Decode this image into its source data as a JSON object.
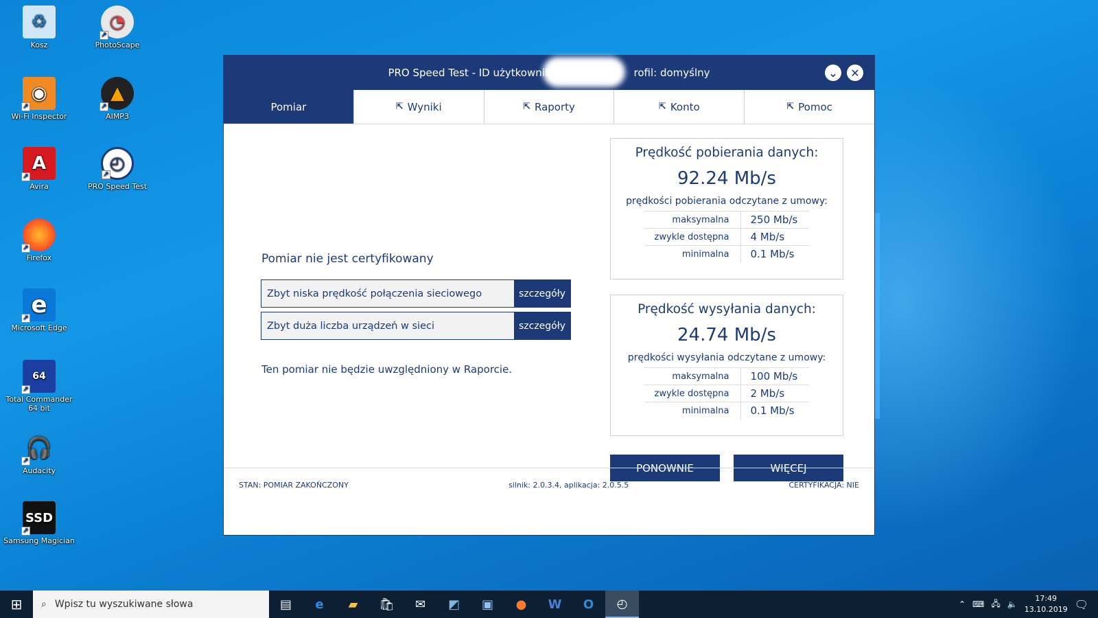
{
  "desktop": {
    "icons": [
      {
        "label": "Kosz",
        "icon": "recycle-bin-icon"
      },
      {
        "label": "PhotoScape",
        "icon": "photoscape-icon"
      },
      {
        "label": "Wi-Fi Inspector",
        "icon": "wifi-inspector-icon"
      },
      {
        "label": "AIMP3",
        "icon": "aimp-icon"
      },
      {
        "label": "Avira",
        "icon": "avira-icon"
      },
      {
        "label": "PRO Speed Test",
        "icon": "speedtest-icon"
      },
      {
        "label": "Firefox",
        "icon": "firefox-icon"
      },
      {
        "label": "Microsoft Edge",
        "icon": "edge-icon"
      },
      {
        "label": "Total Commander 64 bit",
        "icon": "total-commander-icon"
      },
      {
        "label": "Audacity",
        "icon": "audacity-icon"
      },
      {
        "label": "Samsung Magician",
        "icon": "samsung-magician-icon"
      }
    ]
  },
  "window": {
    "title_left": "PRO Speed Test - ID użytkownika",
    "title_right": "rofil: domyślny",
    "tabs": [
      {
        "label": "Pomiar",
        "active": true
      },
      {
        "label": "Wyniki"
      },
      {
        "label": "Raporty"
      },
      {
        "label": "Konto"
      },
      {
        "label": "Pomoc"
      }
    ],
    "not_certified": "Pomiar nie jest certyfikowany",
    "issues": [
      {
        "text": "Zbyt niska prędkość połączenia sieciowego",
        "button": "szczegóły"
      },
      {
        "text": "Zbyt duża liczba urządzeń w sieci",
        "button": "szczegóły"
      }
    ],
    "note": "Ten pomiar nie będzie uwzględniony w Raporcie.",
    "download": {
      "title": "Prędkość pobierania danych:",
      "speed": "92.24 Mb/s",
      "subtitle": "prędkości pobierania odczytane z umowy:",
      "rows": [
        {
          "key": "maksymalna",
          "value": "250 Mb/s"
        },
        {
          "key": "zwykle dostępna",
          "value": "4 Mb/s"
        },
        {
          "key": "minimalna",
          "value": "0.1 Mb/s"
        }
      ]
    },
    "upload": {
      "title": "Prędkość wysyłania danych:",
      "speed": "24.74 Mb/s",
      "subtitle": "prędkości wysyłania odczytane z umowy:",
      "rows": [
        {
          "key": "maksymalna",
          "value": "100 Mb/s"
        },
        {
          "key": "zwykle dostępna",
          "value": "2 Mb/s"
        },
        {
          "key": "minimalna",
          "value": "0.1 Mb/s"
        }
      ]
    },
    "buttons": {
      "again": "PONOWNIE",
      "more": "WIĘCEJ"
    },
    "status": {
      "state": "STAN: POMIAR ZAKOŃCZONY",
      "version": "silnik: 2.0.3.4, aplikacja: 2.0.5.5",
      "cert": "CERTYFIKACJA: NIE"
    }
  },
  "taskbar": {
    "search_placeholder": "Wpisz tu wyszukiwane słowa",
    "time": "17:49",
    "date": "13.10.2019"
  },
  "colors": {
    "primary": "#1c3a78",
    "desktop": "#0a86d8"
  }
}
